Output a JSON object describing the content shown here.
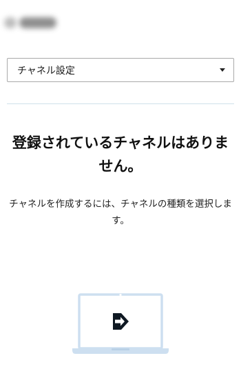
{
  "header": {
    "brand_logo": "blurred-brand-logo"
  },
  "channel_select": {
    "selected_label": "チャネル設定",
    "icon": "chevron-down-icon"
  },
  "empty_state": {
    "title": "登録されているチャネルはありません。",
    "description": "チャネルを作成するには、チャネルの種類を選択します。",
    "illustration_icon": "laptop-arrow-icon"
  },
  "colors": {
    "divider": "#cfe0ea",
    "laptop": "#cddff0",
    "arrow": "#0f1923"
  }
}
